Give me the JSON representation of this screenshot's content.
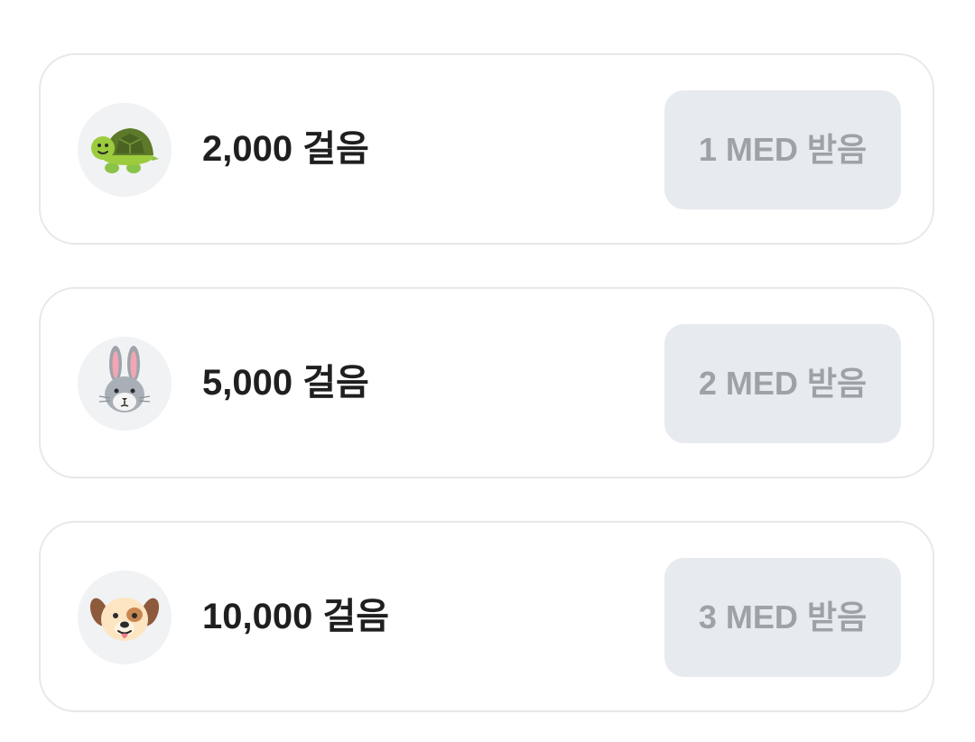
{
  "rewards": [
    {
      "icon": "turtle-icon",
      "steps_label": "2,000 걸음",
      "button_label": "1 MED 받음"
    },
    {
      "icon": "rabbit-icon",
      "steps_label": "5,000 걸음",
      "button_label": "2 MED 받음"
    },
    {
      "icon": "dog-icon",
      "steps_label": "10,000 걸음",
      "button_label": "3 MED 받음"
    }
  ],
  "colors": {
    "card_border": "#e6e8eb",
    "avatar_bg": "#f1f2f4",
    "button_bg": "#e7eaee",
    "button_text": "#9ea2a8",
    "label_text": "#1f1f1f"
  }
}
